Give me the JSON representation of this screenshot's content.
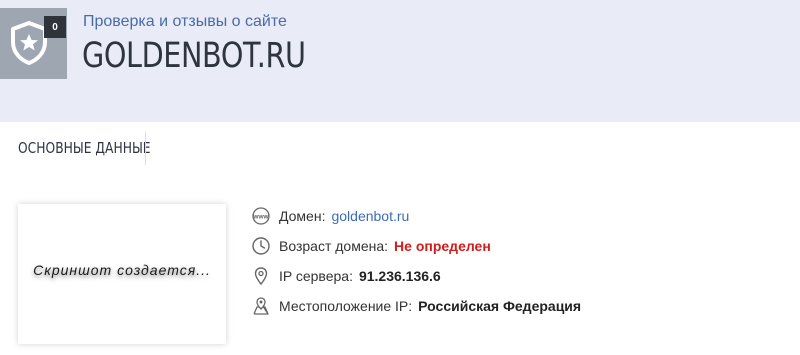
{
  "header": {
    "badge_count": "0",
    "subtitle": "Проверка и отзывы о сайте",
    "site_title": "GOLDENBOT.RU"
  },
  "tabs": [
    {
      "label": "ОСНОВНЫЕ ДАННЫЕ",
      "active": true
    }
  ],
  "screenshot": {
    "placeholder": "Скриншот создается..."
  },
  "info": {
    "domain": {
      "icon": "www-icon",
      "label": "Домен:",
      "value": "goldenbot.ru"
    },
    "age": {
      "icon": "clock-icon",
      "label": "Возраст домена:",
      "value": "Не определен"
    },
    "ip": {
      "icon": "pin-icon",
      "label": "IP сервера:",
      "value": "91.236.136.6"
    },
    "location": {
      "icon": "map-pin-icon",
      "label": "Местоположение IP:",
      "value": "Российская Федерация"
    }
  },
  "colors": {
    "header_bg": "#e9ecf6",
    "subtitle": "#4a6aa8",
    "link": "#3d6ab8",
    "alert": "#d31c1c"
  }
}
